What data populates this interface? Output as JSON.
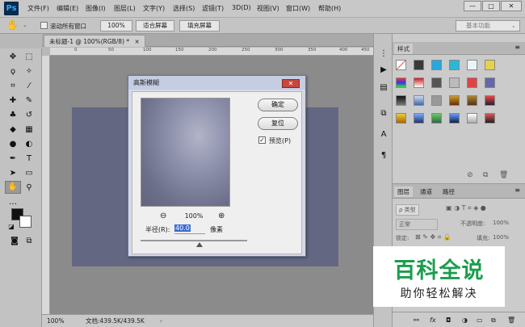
{
  "app": {
    "logo": "Ps"
  },
  "menu": [
    "文件(F)",
    "编辑(E)",
    "图像(I)",
    "图层(L)",
    "文字(Y)",
    "选择(S)",
    "滤镜(T)",
    "3D(D)",
    "视图(V)",
    "窗口(W)",
    "帮助(H)"
  ],
  "window_controls": {
    "minimize": "—",
    "restore": "□",
    "close": "✕"
  },
  "options_bar": {
    "scroll_all_label": "滚动所有窗口",
    "zoom_value": "100%",
    "fit_screen": "适合屏幕",
    "fill_screen": "填充屏幕",
    "workspace": "基本功能"
  },
  "document": {
    "tab_title": "未标题-1 @ 100%(RGB/8) *",
    "close": "×",
    "color": "#646781"
  },
  "ruler_ticks": [
    "0",
    "50",
    "100",
    "150",
    "200",
    "250",
    "300",
    "350",
    "400",
    "450"
  ],
  "status": {
    "zoom": "100%",
    "doc_info": "文档:439.5K/439.5K"
  },
  "dialog": {
    "title": "高斯模糊",
    "ok": "确定",
    "reset": "复位",
    "preview_label": "预览(P)",
    "preview_checked": true,
    "zoom_out": "⊖",
    "zoom_level": "100%",
    "zoom_in": "⊕",
    "radius_label": "半径(R):",
    "radius_value": "40.0",
    "radius_unit": "像素",
    "slider_fraction": 0.55
  },
  "styles_panel": {
    "tab": "样式"
  },
  "layers_panel": {
    "tabs": [
      "图层",
      "通道",
      "路径"
    ],
    "filter_label": "ρ 类型",
    "blend_mode": "正常",
    "opacity_label": "不透明度:",
    "opacity_value": "100%",
    "lock_label": "锁定:",
    "fill_label": "填充:",
    "fill_value": "100%"
  },
  "watermark": {
    "title": "百科全说",
    "subtitle": "助你轻松解决"
  }
}
